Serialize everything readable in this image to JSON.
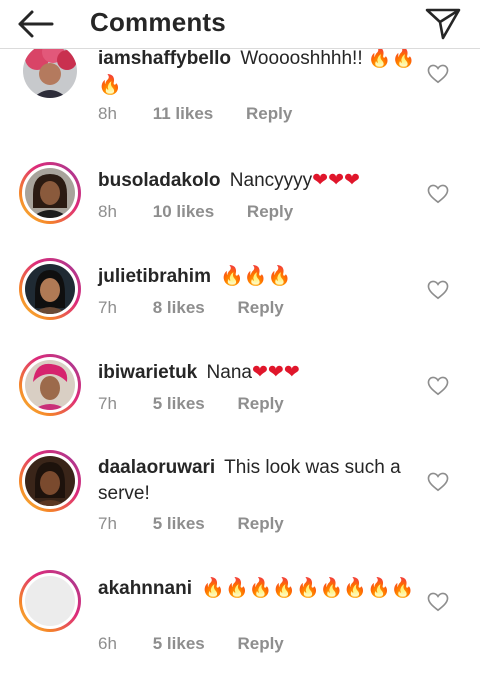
{
  "header": {
    "title": "Comments"
  },
  "comments": [
    {
      "username": "iamshaffybello",
      "text": "Wooooshhhh!! 🔥🔥🔥",
      "time": "8h",
      "likes": "11 likes",
      "reply": "Reply"
    },
    {
      "username": "busoladakolo",
      "text": "Nancyyyy❤❤❤",
      "time": "8h",
      "likes": "10 likes",
      "reply": "Reply"
    },
    {
      "username": "julietibrahim",
      "text": "🔥🔥🔥",
      "time": "7h",
      "likes": "8 likes",
      "reply": "Reply"
    },
    {
      "username": "ibiwarietuk",
      "text": "Nana❤❤❤",
      "time": "7h",
      "likes": "5 likes",
      "reply": "Reply"
    },
    {
      "username": "daalaoruwari",
      "text": "This look was such a serve!",
      "time": "7h",
      "likes": "5 likes",
      "reply": "Reply"
    },
    {
      "username": "akahnnani",
      "text": "🔥🔥🔥🔥🔥🔥🔥🔥🔥",
      "time": "6h",
      "likes": "5 likes",
      "reply": "Reply"
    }
  ],
  "colors": {
    "fire": "#f57c00",
    "heart": "#e0162b",
    "muted": "#8e8e8e",
    "text": "#262626"
  },
  "icons": {
    "back": "arrow-left-icon",
    "share": "paper-plane-icon",
    "like": "heart-outline-icon",
    "fire": "fire-emoji",
    "heart": "red-heart-emoji"
  }
}
